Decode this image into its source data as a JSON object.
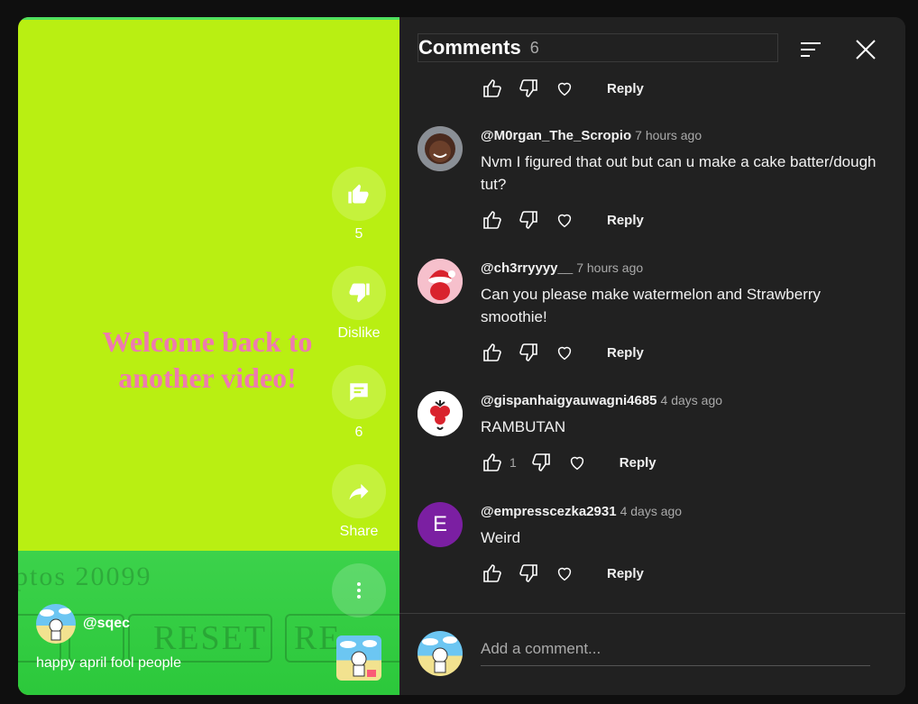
{
  "video": {
    "overlay_text_line1": "Welcome back to",
    "overlay_text_line2": "another video!",
    "bg_text_1": "ptos 20099",
    "bg_text_2": "RESET",
    "bg_text_3": "RE",
    "actions": {
      "like_count": "5",
      "dislike_label": "Dislike",
      "comment_count": "6",
      "share_label": "Share"
    },
    "creator_handle": "@sqec",
    "caption": "happy april fool people"
  },
  "comments_panel": {
    "title": "Comments",
    "count": "6",
    "reply_label": "Reply",
    "comments": [
      {
        "author": "@M0rgan_The_Scropio",
        "time": "7 hours ago",
        "text": "Nvm I figured that out but can u make a cake batter/dough tut?",
        "likes": ""
      },
      {
        "author": "@ch3rryyyy__",
        "time": "7 hours ago",
        "text": "Can you please make watermelon and Strawberry smoothie!",
        "likes": ""
      },
      {
        "author": "@gispanhaigyauwagni4685",
        "time": "4 days ago",
        "text": "RAMBUTAN",
        "likes": "1"
      },
      {
        "author": "@empresscezka2931",
        "time": "4 days ago",
        "text": "Weird",
        "likes": "",
        "avatar_letter": "E"
      }
    ],
    "add_comment_placeholder": "Add a comment..."
  },
  "colors": {
    "video_bg": "#b9ef12",
    "overlay_text": "#ee7ab0",
    "panel_bg": "#212121",
    "avatar_purple": "#7b1fa2"
  }
}
